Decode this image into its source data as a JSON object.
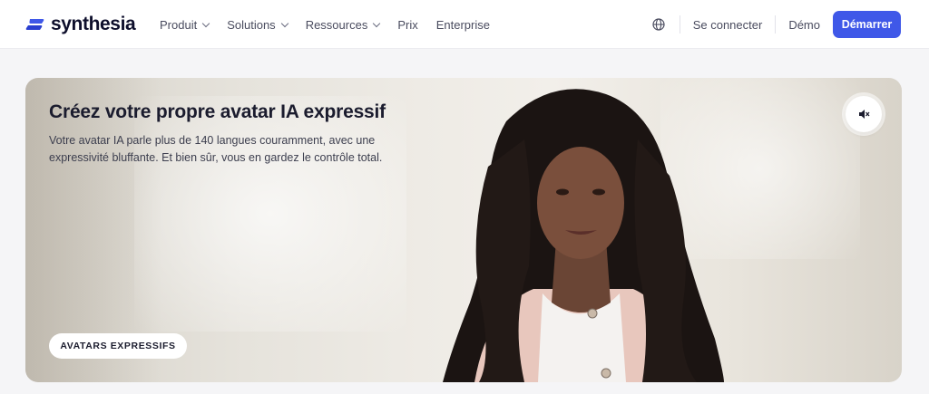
{
  "brand": {
    "name": "synthesia",
    "accent": "#3f58e8"
  },
  "nav": {
    "items": [
      {
        "label": "Produit",
        "dropdown": true
      },
      {
        "label": "Solutions",
        "dropdown": true
      },
      {
        "label": "Ressources",
        "dropdown": true
      },
      {
        "label": "Prix",
        "dropdown": false
      },
      {
        "label": "Enterprise",
        "dropdown": false
      }
    ],
    "login": "Se connecter",
    "demo": "Démo",
    "cta": "Démarrer",
    "language_icon": "globe-icon"
  },
  "hero": {
    "title": "Créez votre propre avatar IA expressif",
    "description": "Votre avatar IA parle plus de 140 langues couramment, avec une expressivité bluffante. Et bien sûr, vous en gardez le contrôle total.",
    "tag": "AVATARS EXPRESSIFS",
    "sound_icon": "speaker-muted-icon"
  }
}
